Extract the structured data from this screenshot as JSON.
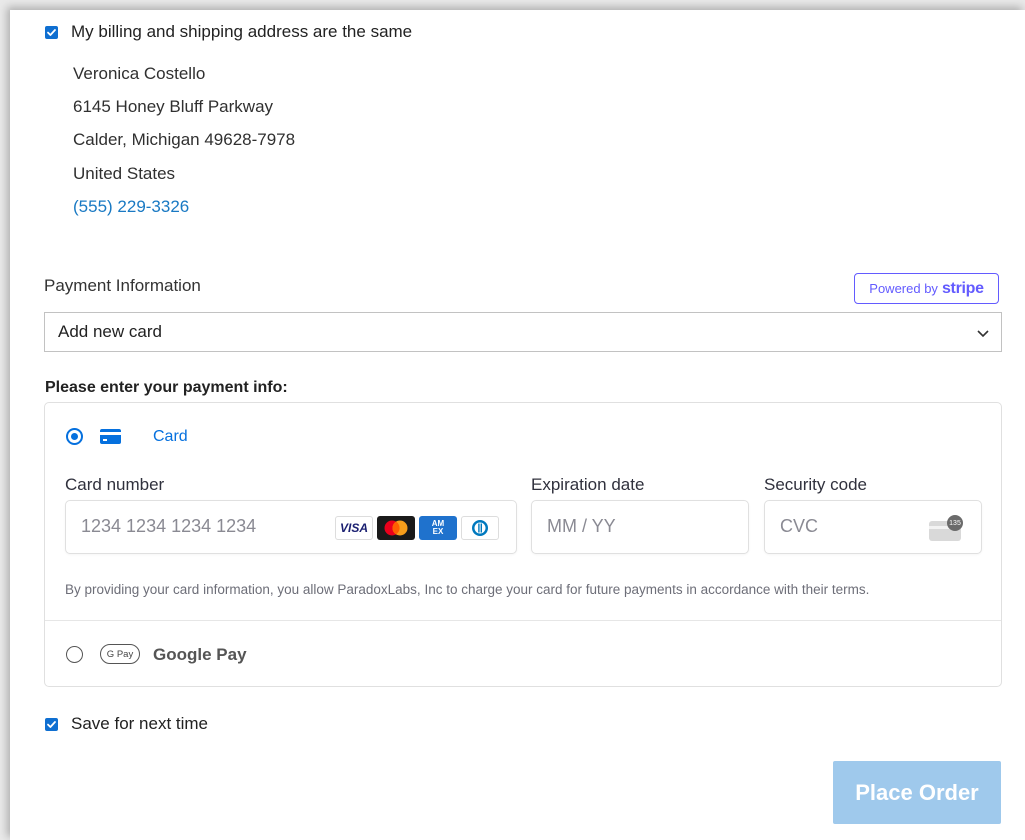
{
  "billing": {
    "same_address_label": "My billing and shipping address are the same",
    "same_address_checked": true,
    "address": {
      "name": "Veronica Costello",
      "street": "6145 Honey Bluff Parkway",
      "city_line": "Calder, Michigan 49628-7978",
      "country": "United States",
      "phone": "(555) 229-3326"
    }
  },
  "payment": {
    "section_label": "Payment Information",
    "stripe_badge": {
      "prefix": "Powered by",
      "brand": "stripe"
    },
    "card_select": {
      "selected": "Add new card"
    },
    "heading": "Please enter your payment info:",
    "methods": {
      "card": {
        "label": "Card",
        "selected": true,
        "card_number_label": "Card number",
        "card_number_placeholder": "1234 1234 1234 1234",
        "expiry_label": "Expiration date",
        "expiry_placeholder": "MM / YY",
        "cvc_label": "Security code",
        "cvc_placeholder": "CVC",
        "cvc_icon_text": "135",
        "brands": {
          "visa": "VISA",
          "amex": "AM EX"
        },
        "disclaimer": "By providing your card information, you allow ParadoxLabs, Inc to charge your card for future payments in accordance with their terms."
      },
      "google_pay": {
        "label": "Google Pay",
        "pill_text": "G Pay",
        "selected": false
      }
    }
  },
  "save_for_next_time": {
    "label": "Save for next time",
    "checked": true
  },
  "place_order": {
    "label": "Place Order"
  },
  "colors": {
    "accent": "#0570de",
    "link": "#1979c3",
    "stripe": "#635bff",
    "button_disabled": "#9fc9ec"
  }
}
